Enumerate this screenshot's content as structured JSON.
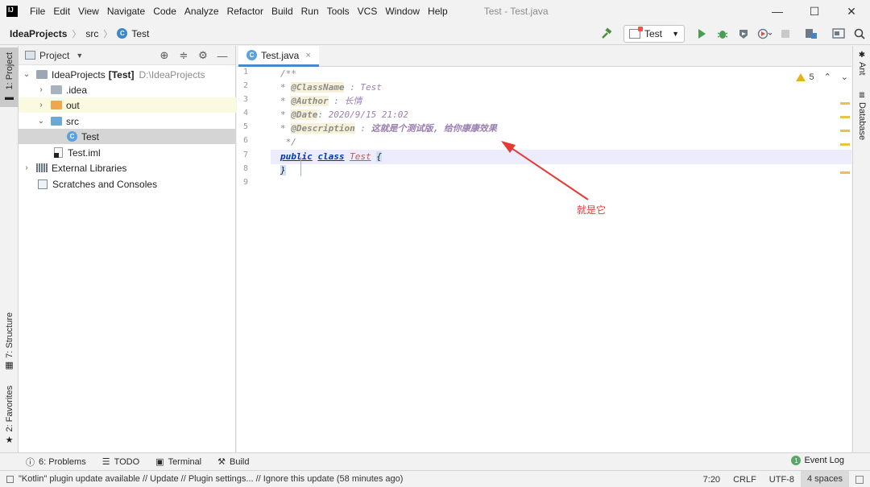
{
  "menubar": {
    "logo": "IJ",
    "items": [
      "File",
      "Edit",
      "View",
      "Navigate",
      "Code",
      "Analyze",
      "Refactor",
      "Build",
      "Run",
      "Tools",
      "VCS",
      "Window",
      "Help"
    ],
    "window_title": "Test - Test.java",
    "controls": {
      "minimize": "—",
      "maximize": "☐",
      "close": "✕"
    }
  },
  "navbar": {
    "crumbs": [
      "IdeaProjects",
      "src",
      "Test"
    ],
    "separator": "〉",
    "class_icon_letter": "C",
    "run_config": "Test",
    "icons": {
      "build": "hammer-icon",
      "run": "run-icon",
      "debug": "debug-icon",
      "coverage": "coverage-icon",
      "profile": "profile-icon",
      "stop": "stop-icon",
      "project_structure": "project-structure-icon",
      "sdk": "sdk-icon",
      "search": "search-icon"
    }
  },
  "left_stripe": {
    "project": "1: Project",
    "structure": "7: Structure",
    "favorites": "2: Favorites"
  },
  "project_panel": {
    "title": "Project",
    "tree": {
      "root_name": "IdeaProjects",
      "root_module": "[Test]",
      "root_path": "D:\\IdeaProjects",
      "idea": ".idea",
      "out": "out",
      "src": "src",
      "test_class": "Test",
      "test_iml": "Test.iml",
      "external_libraries": "External Libraries",
      "scratches": "Scratches and Consoles"
    }
  },
  "editor": {
    "tab_label": "Test.java",
    "tab_close": "×",
    "line_numbers": [
      "1",
      "2",
      "3",
      "4",
      "5",
      "6",
      "7",
      "8",
      "9"
    ],
    "code": {
      "l1": "/**",
      "l2_tag": "@ClassName",
      "l2_val": "Test",
      "l3_tag": "@Author",
      "l3_val": "长情",
      "l4_tag": "@Date",
      "l4_val": "2020/9/15  21:02",
      "l5_tag": "@Description",
      "l5_val": "这就是个测试版, 给你康康效果",
      "l6": "*/",
      "l7_kw1": "public",
      "l7_kw2": "class",
      "l7_cls": "Test",
      "l7_brace": "{",
      "l8_brace": "}"
    },
    "inspection_count": "5",
    "cursor_line": 7
  },
  "annotation": {
    "text": "就是它",
    "color": "#e53935"
  },
  "right_stripe": {
    "ant": "Ant",
    "database": "Database"
  },
  "bottom_tools": {
    "problems": "6: Problems",
    "todo": "TODO",
    "terminal": "Terminal",
    "build": "Build",
    "event_log": "Event Log",
    "event_badge": "1"
  },
  "statusbar": {
    "message": "\"Kotlin\" plugin update available // Update // Plugin settings... // Ignore this update (58 minutes ago)",
    "position": "7:20",
    "line_sep": "CRLF",
    "encoding": "UTF-8",
    "indent": "4 spaces"
  },
  "colors": {
    "accent": "#4a88c7",
    "keyword": "#0033b3",
    "comment": "#8c8c8c",
    "warning": "#e8b31a",
    "run_green": "#499c54"
  }
}
